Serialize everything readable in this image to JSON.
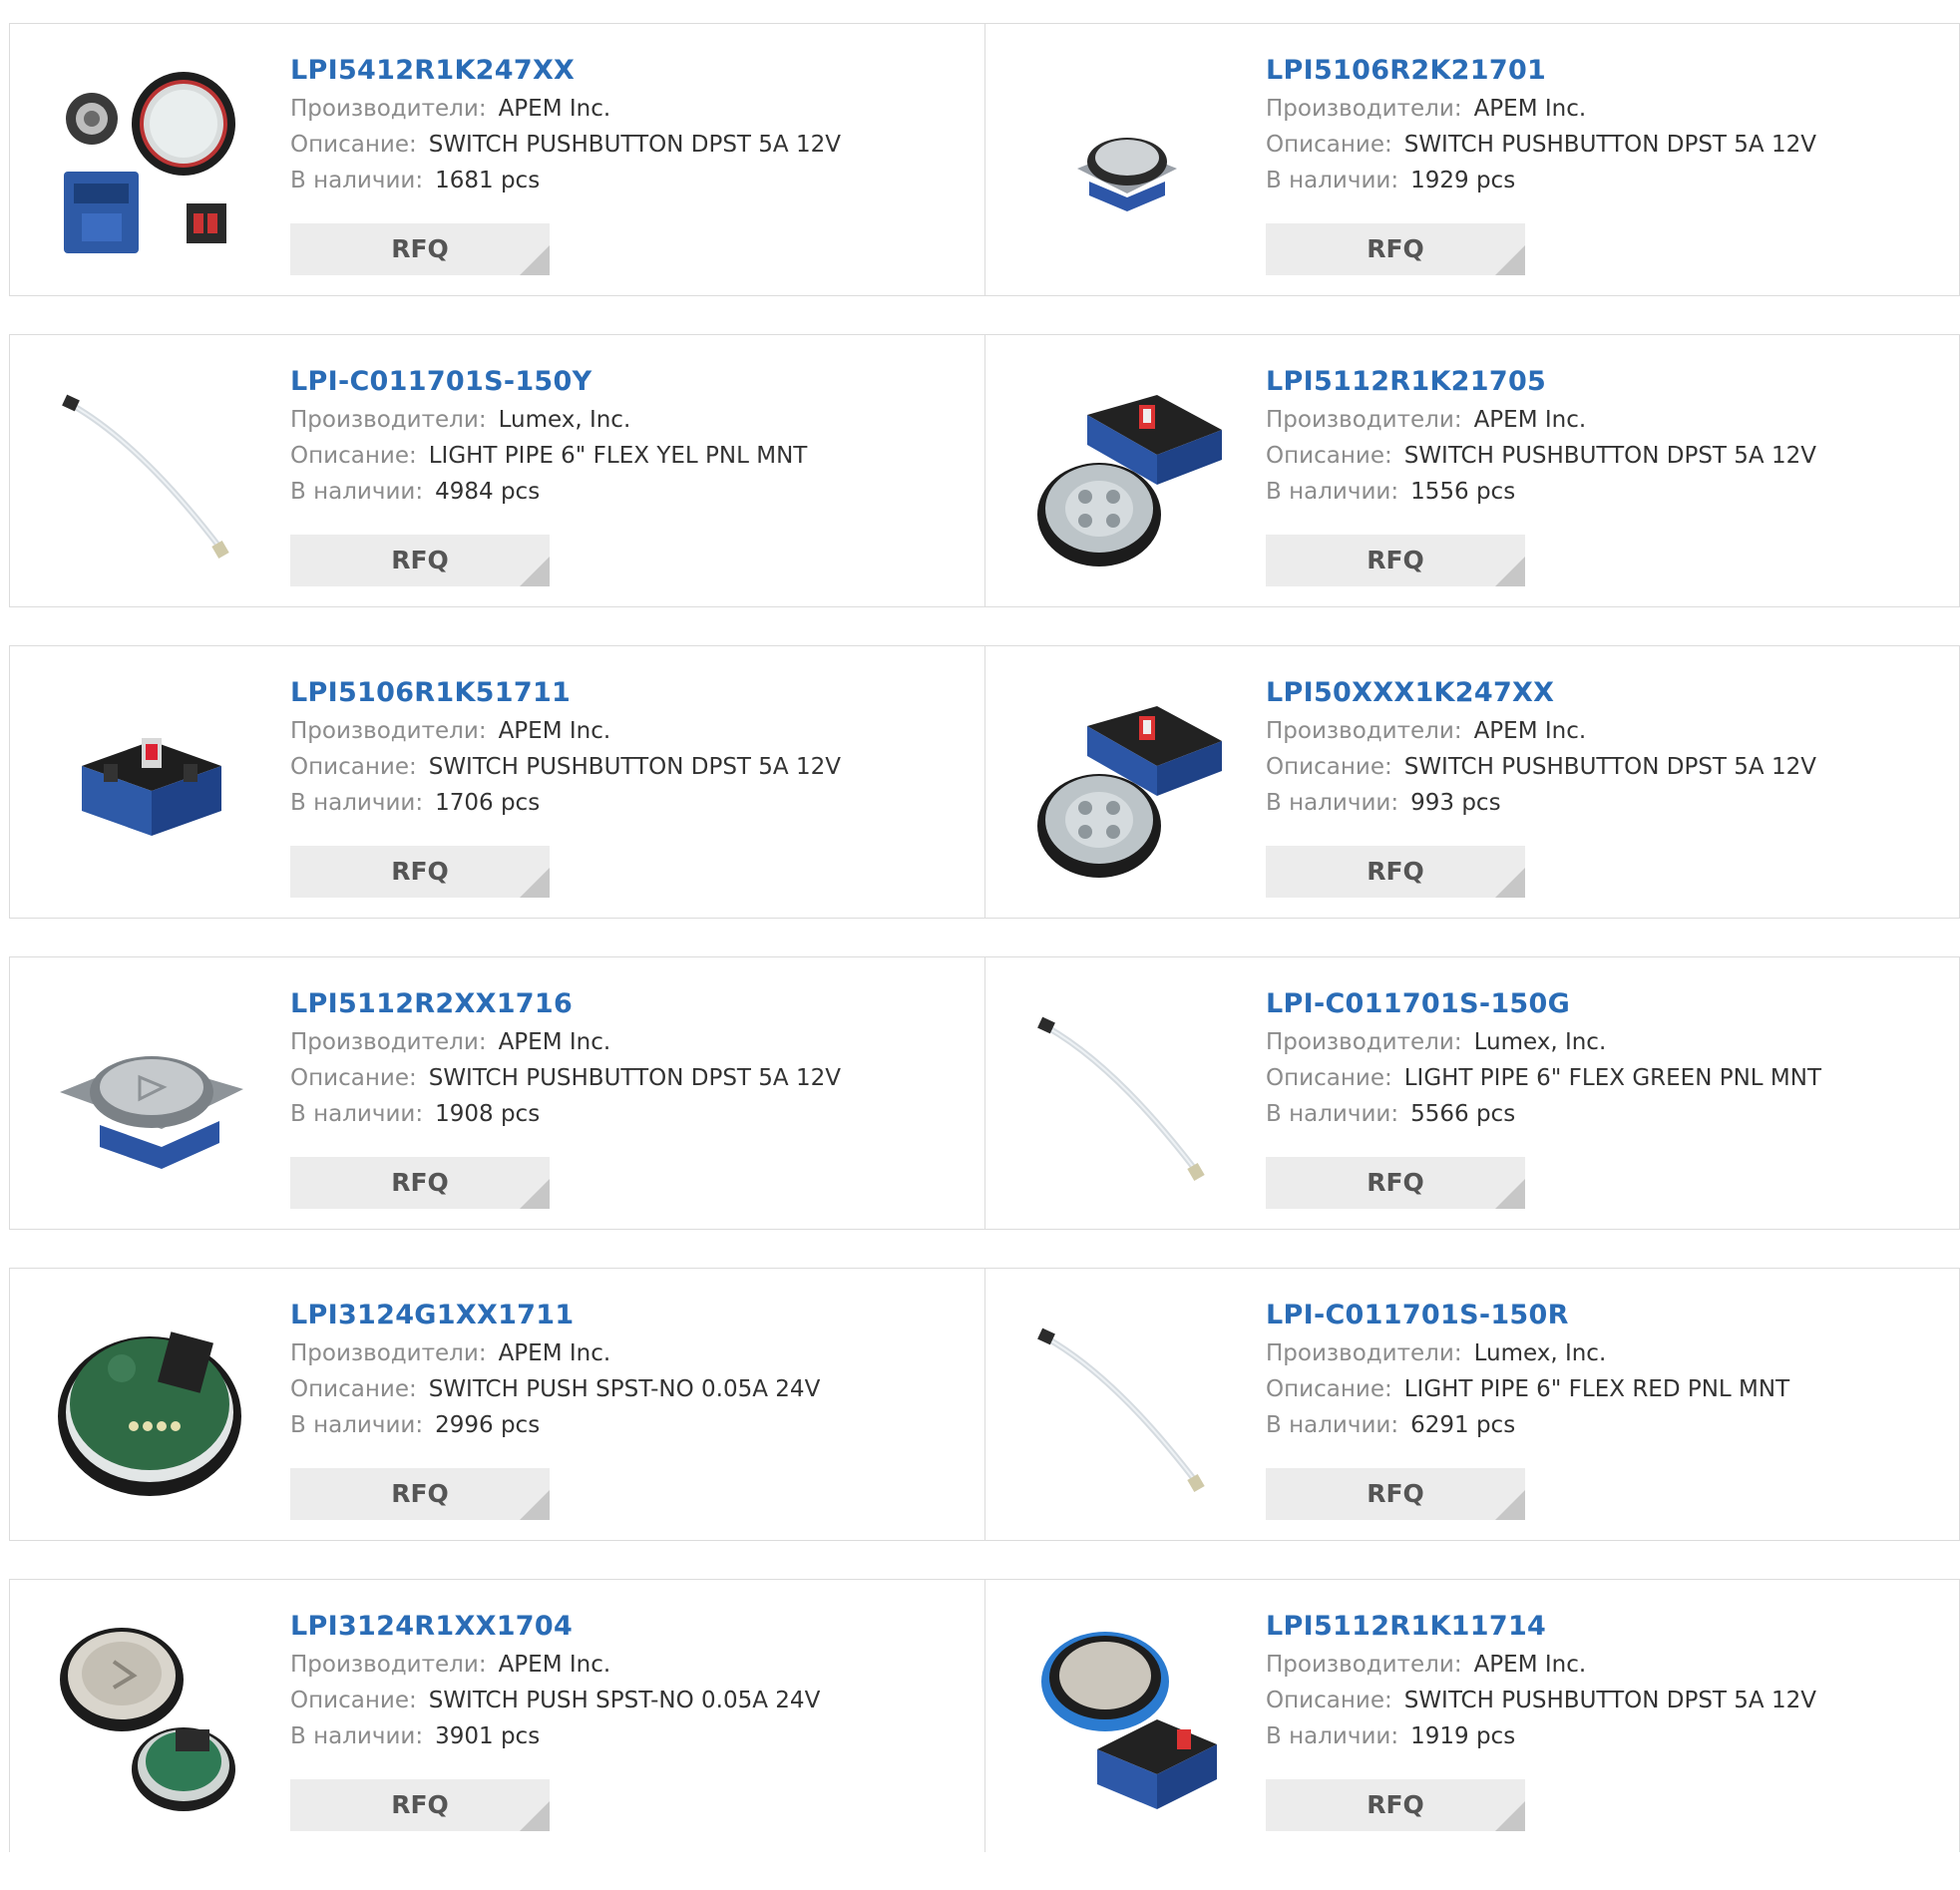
{
  "labels": {
    "manufacturer": "Производители:",
    "description": "Описание:",
    "stock": "В наличии:",
    "rfq": "RFQ"
  },
  "products": [
    {
      "part": "LPI5412R1K247XX",
      "manufacturer": "APEM Inc.",
      "description": "SWITCH PUSHBUTTON DPST 5A 12V",
      "stock": "1681 pcs",
      "image": "pushbutton-kit-image"
    },
    {
      "part": "LPI5106R2K21701",
      "manufacturer": "APEM Inc.",
      "description": "SWITCH PUSHBUTTON DPST 5A 12V",
      "stock": "1929 pcs",
      "image": "square-pushbutton-image"
    },
    {
      "part": "LPI-C011701S-150Y",
      "manufacturer": "Lumex, Inc.",
      "description": "LIGHT PIPE 6\" FLEX YEL PNL MNT",
      "stock": "4984 pcs",
      "image": "light-pipe-image"
    },
    {
      "part": "LPI5112R1K21705",
      "manufacturer": "APEM Inc.",
      "description": "SWITCH PUSHBUTTON DPST 5A 12V",
      "stock": "1556 pcs",
      "image": "switch-housing-and-bezel-image"
    },
    {
      "part": "LPI5106R1K51711",
      "manufacturer": "APEM Inc.",
      "description": "SWITCH PUSHBUTTON DPST 5A 12V",
      "stock": "1706 pcs",
      "image": "switch-housing-image"
    },
    {
      "part": "LPI50XXX1K247XX",
      "manufacturer": "APEM Inc.",
      "description": "SWITCH PUSHBUTTON DPST 5A 12V",
      "stock": "993 pcs",
      "image": "switch-housing-and-bezel-image"
    },
    {
      "part": "LPI5112R2XX1716",
      "manufacturer": "APEM Inc.",
      "description": "SWITCH PUSHBUTTON DPST 5A 12V",
      "stock": "1908 pcs",
      "image": "arrow-pushbutton-image"
    },
    {
      "part": "LPI-C011701S-150G",
      "manufacturer": "Lumex, Inc.",
      "description": "LIGHT PIPE 6\" FLEX GREEN PNL MNT",
      "stock": "5566 pcs",
      "image": "light-pipe-image"
    },
    {
      "part": "LPI3124G1XX1711",
      "manufacturer": "APEM Inc.",
      "description": "SWITCH PUSH SPST-NO 0.05A 24V",
      "stock": "2996 pcs",
      "image": "pcb-pushbutton-image"
    },
    {
      "part": "LPI-C011701S-150R",
      "manufacturer": "Lumex, Inc.",
      "description": "LIGHT PIPE 6\" FLEX RED PNL MNT",
      "stock": "6291 pcs",
      "image": "light-pipe-image"
    },
    {
      "part": "LPI3124R1XX1704",
      "manufacturer": "APEM Inc.",
      "description": "SWITCH PUSH SPST-NO 0.05A 24V",
      "stock": "3901 pcs",
      "image": "round-pushbutton-pair-image"
    },
    {
      "part": "LPI5112R1K11714",
      "manufacturer": "APEM Inc.",
      "description": "SWITCH PUSHBUTTON DPST 5A 12V",
      "stock": "1919 pcs",
      "image": "blue-ring-pushbutton-image"
    }
  ]
}
